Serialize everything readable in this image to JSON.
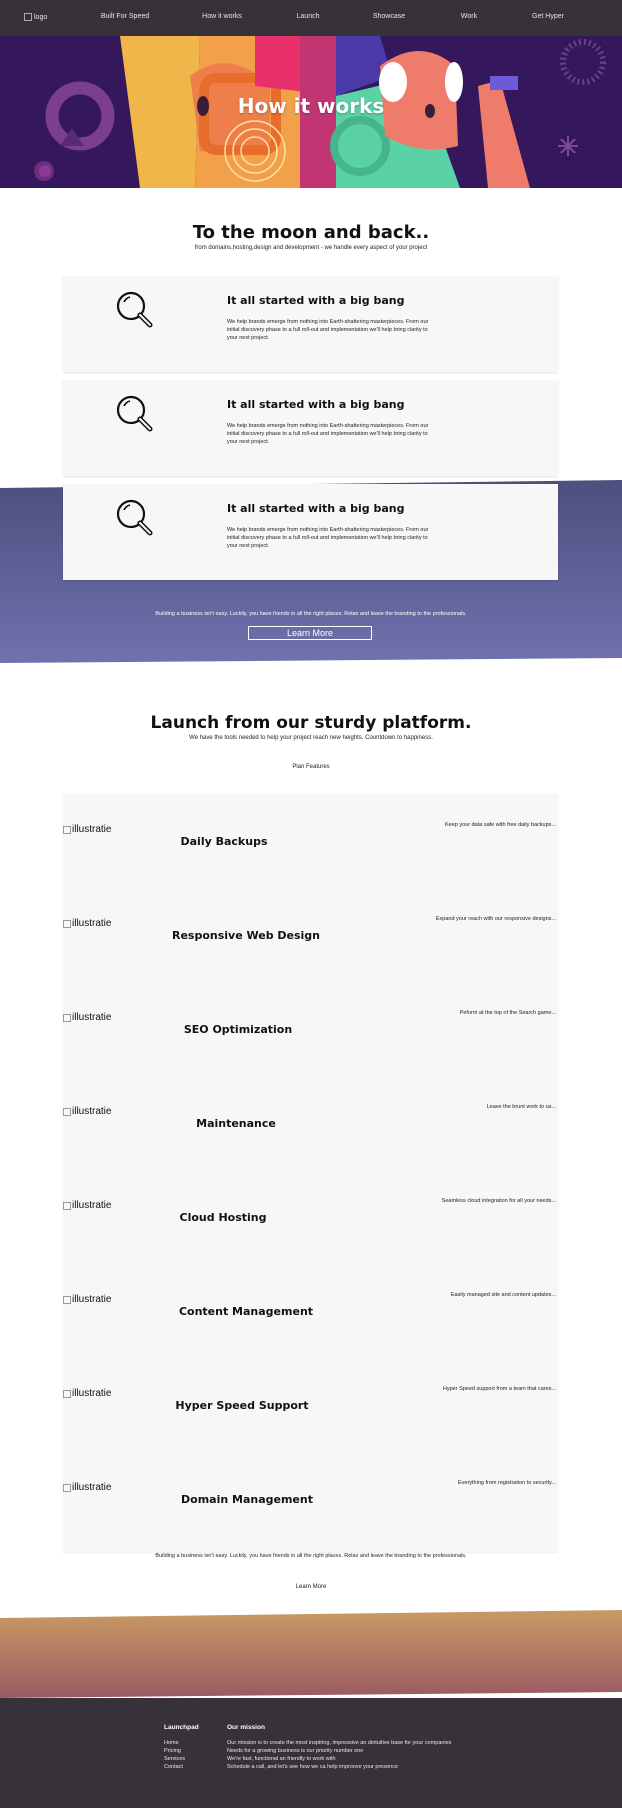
{
  "nav": {
    "logo_alt": "logo",
    "items": [
      "Built For Speed",
      "How it works",
      "Launch",
      "Showcase",
      "Work",
      "Get Hyper"
    ]
  },
  "hero": {
    "title": "How it works"
  },
  "intro": {
    "title": "To the moon and back..",
    "subtitle": "from domains,hosting,design and development - we handle every aspect of your project"
  },
  "cards": [
    {
      "icon": "magnifier-icon",
      "title": "It all started with a big bang",
      "text": "We help brands emerge from nothing into Earth-shattering masterpieces. From our initial discovery phase to a full roll-out and implementation we'll help bring clarity to your next project."
    },
    {
      "icon": "magnifier-icon",
      "title": "It all started with a big bang",
      "text": "We help brands emerge from nothing into Earth-shattering masterpieces. From our initial discovery phase to a full roll-out and implementation we'll help bring clarity to your next project."
    },
    {
      "icon": "magnifier-icon",
      "title": "It all started with a big bang",
      "text": "We help brands emerge from nothing into Earth-shattering masterpieces. From our initial discovery phase to a full roll-out and implementation we'll help bring clarity to your next project."
    }
  ],
  "band": {
    "text": "Building a business isn't easy. Luckily, you have friends in all the right places. Relax and leave the branding to the professionals.",
    "button": "Learn More",
    "colors": {
      "top": "#4d4f7f",
      "bottom": "#6f72ad"
    }
  },
  "launch": {
    "title": "Launch from our sturdy platform.",
    "subtitle": "We have the tools needed to help your project reach new heights. Countdown to happiness.",
    "plan_features": "Plan Features"
  },
  "features": [
    {
      "illustration_alt": "illustratie",
      "name": "Daily Backups",
      "desc": "Keep your data safe with free daily backups..."
    },
    {
      "illustration_alt": "illustratie",
      "name": "Responsive Web Design",
      "desc": "Expand your reach with our responsive designs..."
    },
    {
      "illustration_alt": "illustratie",
      "name": "SEO Optimization",
      "desc": "Peform at the top of the Search game..."
    },
    {
      "illustration_alt": "illustratie",
      "name": "Maintenance",
      "desc": "Leave the brunt work to us..."
    },
    {
      "illustration_alt": "illustratie",
      "name": "Cloud Hosting",
      "desc": "Seamless cloud integration for all your needs..."
    },
    {
      "illustration_alt": "illustratie",
      "name": "Content Management",
      "desc": "Easily managed site and content updates..."
    },
    {
      "illustration_alt": "illustratie",
      "name": "Hyper Speed Support",
      "desc": "Hyper Speed support from a team that cares..."
    },
    {
      "illustration_alt": "illustratie",
      "name": "Domain Management",
      "desc": "Everything from registration to security..."
    }
  ],
  "bottom": {
    "text": "Building a business isn't easy. Luckily, you have friends in all the right places. Relax and leave the branding to the professionals.",
    "more": "Learn More",
    "gradient": {
      "top": "#c99a63",
      "bottom": "#9a5a63"
    }
  },
  "footer": {
    "col1_title": "Launchpad",
    "links": [
      "Home",
      "Pricing",
      "Services",
      "Contact"
    ],
    "col2_title": "Our mission",
    "mission": [
      "Our mission is to create the most inspiring, impressive an dintuitive base for your companies",
      "Needs for a growing business is our priority number one",
      "We're fast, functional an friendly to work with",
      "Schedule a call, and let's see how we ca help improove your presence"
    ],
    "bg": "#37323a"
  }
}
